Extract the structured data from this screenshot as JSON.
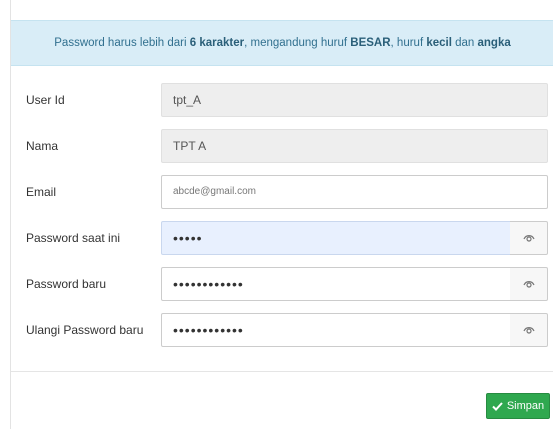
{
  "alert": {
    "text_1": "Password harus lebih dari ",
    "bold_1": "6 karakter",
    "text_2": ", mengandung huruf ",
    "bold_2": "BESAR",
    "text_3": ", huruf ",
    "bold_3": "kecil",
    "text_4": " dan ",
    "bold_4": "angka"
  },
  "form": {
    "user_id": {
      "label": "User Id",
      "value": "tpt_A"
    },
    "nama": {
      "label": "Nama",
      "value": "TPT A"
    },
    "email": {
      "label": "Email",
      "value": "abcde@gmail.com"
    },
    "current_password": {
      "label": "Password saat ini",
      "value": "•••••",
      "icon": "eye-icon"
    },
    "new_password": {
      "label": "Password baru",
      "value": "••••••••••••",
      "icon": "eye-icon"
    },
    "confirm_password": {
      "label": "Ulangi Password baru",
      "value": "••••••••••••",
      "icon": "eye-icon"
    }
  },
  "actions": {
    "save_label": "Simpan",
    "save_icon": "check-icon",
    "save_color": "#2fa84f"
  },
  "colors": {
    "alert_bg": "#d9edf7",
    "alert_text": "#31708f",
    "focus_bg": "#e8f0fe"
  }
}
